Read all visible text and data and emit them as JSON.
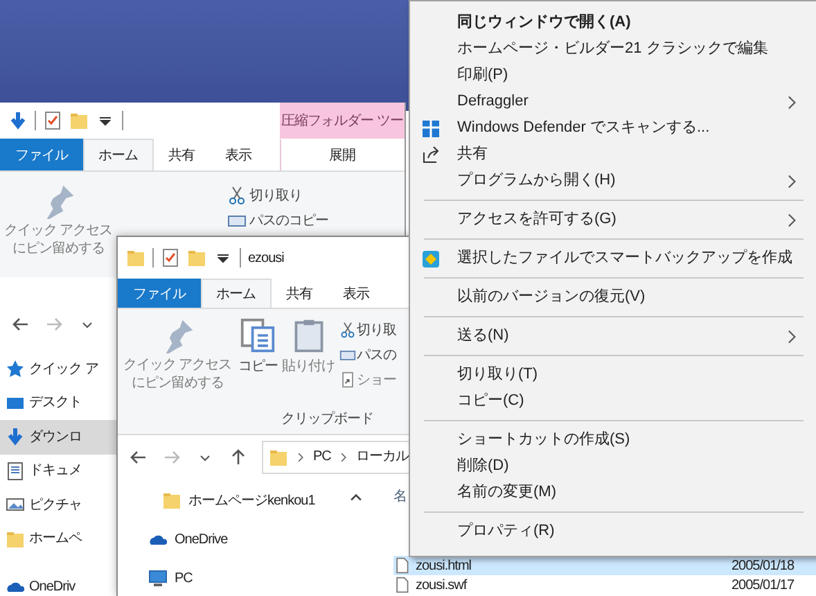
{
  "back_window": {
    "contextual_tab_group": "圧縮フォルダー ツー",
    "tabs": [
      {
        "label": "ファイル",
        "kind": "file",
        "selected": false
      },
      {
        "label": "ホーム",
        "kind": "normal",
        "selected": true
      },
      {
        "label": "共有",
        "kind": "normal",
        "selected": false
      },
      {
        "label": "表示",
        "kind": "normal",
        "selected": false
      },
      {
        "label": "展開",
        "kind": "contextual",
        "selected": false
      }
    ],
    "ribbon": {
      "pin_lines": [
        "クイック アクセス",
        "にピン留めする"
      ],
      "small_commands": [
        "切り取り",
        "パスのコピー"
      ]
    },
    "nav_pane": [
      {
        "label": "クイック ア",
        "selected": false
      },
      {
        "label": "デスクト",
        "selected": false
      },
      {
        "label": "ダウンロ",
        "selected": true
      },
      {
        "label": "ドキュメ",
        "selected": false
      },
      {
        "label": "ピクチャ",
        "selected": false
      },
      {
        "label": "ホームペ",
        "selected": false
      },
      {
        "label": "OneDriv",
        "selected": false
      }
    ]
  },
  "front_window": {
    "title": "ezousi",
    "tabs": [
      {
        "label": "ファイル",
        "kind": "file",
        "selected": false
      },
      {
        "label": "ホーム",
        "kind": "normal",
        "selected": true
      },
      {
        "label": "共有",
        "kind": "normal",
        "selected": false
      },
      {
        "label": "表示",
        "kind": "normal",
        "selected": false
      }
    ],
    "ribbon": {
      "pin_lines": [
        "クイック アクセス",
        "にピン留めする"
      ],
      "large_commands": [
        "コピー",
        "貼り付け"
      ],
      "small_commands": [
        "切り取",
        "パスの",
        "ショー"
      ],
      "group_label": "クリップボード"
    },
    "address": [
      "PC",
      "ローカル"
    ],
    "nav_pane": [
      "ホームページkenkou1",
      "OneDrive",
      "PC"
    ],
    "column_header": "名",
    "files": [
      {
        "name": "zousi.html",
        "date": "2005/01/18",
        "selected": true
      },
      {
        "name": "zousi.swf",
        "date": "2005/01/17",
        "selected": false
      }
    ]
  },
  "context_menu": [
    {
      "kind": "item",
      "label": "同じウィンドウで開く(A)",
      "default": true,
      "submenu": false
    },
    {
      "kind": "item",
      "label": "ホームページ・ビルダー21 クラシックで編集",
      "default": false,
      "submenu": false
    },
    {
      "kind": "item",
      "label": "印刷(P)",
      "default": false,
      "submenu": false
    },
    {
      "kind": "item",
      "label": "Defraggler",
      "default": false,
      "submenu": true
    },
    {
      "kind": "item",
      "label": "Windows Defender でスキャンする...",
      "default": false,
      "submenu": false
    },
    {
      "kind": "item",
      "label": "共有",
      "default": false,
      "submenu": false
    },
    {
      "kind": "item",
      "label": "プログラムから開く(H)",
      "default": false,
      "submenu": true
    },
    {
      "kind": "separator"
    },
    {
      "kind": "item",
      "label": "アクセスを許可する(G)",
      "default": false,
      "submenu": true
    },
    {
      "kind": "separator"
    },
    {
      "kind": "item",
      "label": "選択したファイルでスマートバックアップを作成",
      "default": false,
      "submenu": false
    },
    {
      "kind": "separator"
    },
    {
      "kind": "item",
      "label": "以前のバージョンの復元(V)",
      "default": false,
      "submenu": false
    },
    {
      "kind": "separator"
    },
    {
      "kind": "item",
      "label": "送る(N)",
      "default": false,
      "submenu": true
    },
    {
      "kind": "separator"
    },
    {
      "kind": "item",
      "label": "切り取り(T)",
      "default": false,
      "submenu": false
    },
    {
      "kind": "item",
      "label": "コピー(C)",
      "default": false,
      "submenu": false
    },
    {
      "kind": "separator"
    },
    {
      "kind": "item",
      "label": "ショートカットの作成(S)",
      "default": false,
      "submenu": false
    },
    {
      "kind": "item",
      "label": "削除(D)",
      "default": false,
      "submenu": false
    },
    {
      "kind": "item",
      "label": "名前の変更(M)",
      "default": false,
      "submenu": false
    },
    {
      "kind": "separator"
    },
    {
      "kind": "item",
      "label": "プロパティ(R)",
      "default": false,
      "submenu": false
    }
  ]
}
